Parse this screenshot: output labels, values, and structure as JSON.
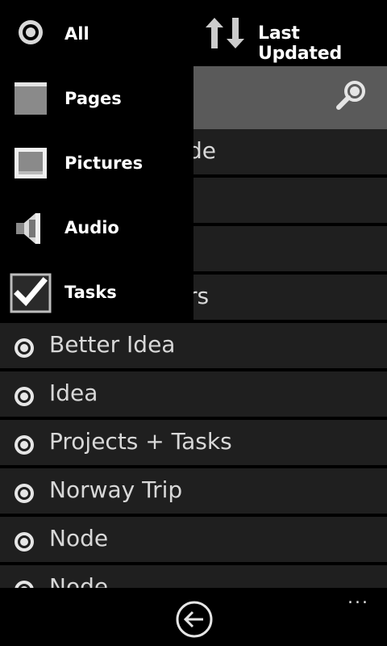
{
  "header": {
    "sort_icon": "sort-up-down-icon",
    "sort_label": "Last Updated"
  },
  "search": {
    "icon": "search-icon"
  },
  "filter_menu": {
    "items": [
      {
        "label": "All",
        "icon": "radio-icon"
      },
      {
        "label": "Pages",
        "icon": "page-icon"
      },
      {
        "label": "Pictures",
        "icon": "picture-icon"
      },
      {
        "label": "Audio",
        "icon": "speaker-icon"
      },
      {
        "label": "Tasks",
        "icon": "checkbox-icon"
      }
    ]
  },
  "list": {
    "hidden_fragments": [
      "de",
      "",
      "",
      "rs"
    ],
    "items": [
      {
        "label": "Better Idea"
      },
      {
        "label": "Idea"
      },
      {
        "label": "Projects + Tasks"
      },
      {
        "label": "Norway Trip"
      },
      {
        "label": "Node"
      },
      {
        "label": "Node"
      }
    ]
  },
  "appbar": {
    "back_icon": "back-arrow-icon",
    "more_label": "..."
  },
  "colors": {
    "background": "#000000",
    "row": "#1f1f1f",
    "search_bar": "#5a5a5a",
    "text_dim": "#d8d8d8"
  }
}
